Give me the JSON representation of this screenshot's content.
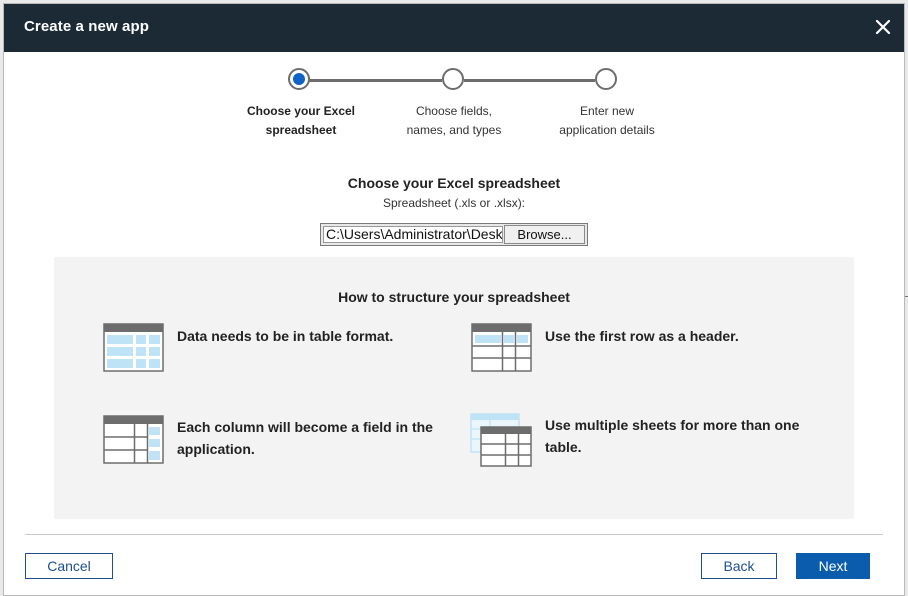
{
  "dialog": {
    "title": "Create a new app",
    "close_icon": "close-icon"
  },
  "stepper": {
    "steps": [
      {
        "line1": "Choose your Excel",
        "line2": "spreadsheet",
        "active": true
      },
      {
        "line1": "Choose fields,",
        "line2": "names, and types",
        "active": false
      },
      {
        "line1": "Enter new",
        "line2": "application details",
        "active": false
      }
    ]
  },
  "upload": {
    "heading": "Choose your Excel spreadsheet",
    "subheading": "Spreadsheet (.xls or .xlsx):",
    "file_path": "C:\\Users\\Administrator\\Desktop",
    "browse_label": "Browse..."
  },
  "tips": {
    "heading": "How to structure your spreadsheet",
    "items": [
      {
        "icon": "table-format-icon",
        "text": "Data needs to be in table format."
      },
      {
        "icon": "header-row-icon",
        "text": "Use the first row as a header."
      },
      {
        "icon": "column-field-icon",
        "line1": "Each column will become a field in the",
        "line2": "application."
      },
      {
        "icon": "multiple-sheets-icon",
        "line1": "Use multiple sheets for more than one",
        "line2": "table."
      }
    ]
  },
  "footer": {
    "cancel_label": "Cancel",
    "back_label": "Back",
    "next_label": "Next"
  },
  "colors": {
    "titlebar": "#1c2a36",
    "accent": "#0b5cad",
    "active_step": "#0f62c8",
    "panel": "#f3f3f3",
    "icon_highlight": "#bfe3f6"
  }
}
